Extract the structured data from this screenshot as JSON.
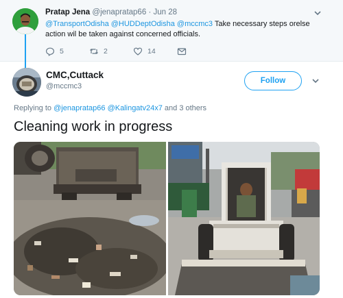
{
  "parent_tweet": {
    "author_name": "Pratap Jena",
    "author_handle": "@jenapratap66",
    "separator": "·",
    "date": "Jun 28",
    "mentions": [
      "@TransportOdisha",
      "@HUDDeptOdisha",
      "@mccmc3"
    ],
    "body_text": "Take necessary steps orelse action wil be taken against concerned officials.",
    "actions": {
      "reply_count": "5",
      "retweet_count": "2",
      "like_count": "14"
    },
    "icons": [
      "reply-icon",
      "retweet-icon",
      "like-icon",
      "message-icon",
      "chevron-down-icon"
    ]
  },
  "main_tweet": {
    "author_name": "CMC,Cuttack",
    "author_handle": "@mccmc3",
    "follow_label": "Follow",
    "reply_prefix": "Replying to",
    "reply_mentions": [
      "@jenapratap66",
      "@Kalingatv24x7"
    ],
    "reply_suffix": "and 3 others",
    "text": "Cleaning work in progress",
    "photos": [
      "garbage-site-photo",
      "skid-steer-loader-photo"
    ]
  },
  "colors": {
    "accent": "#1da1f2",
    "link": "#1b95e0",
    "muted": "#657786",
    "parent_bg": "#f5f8fa"
  }
}
